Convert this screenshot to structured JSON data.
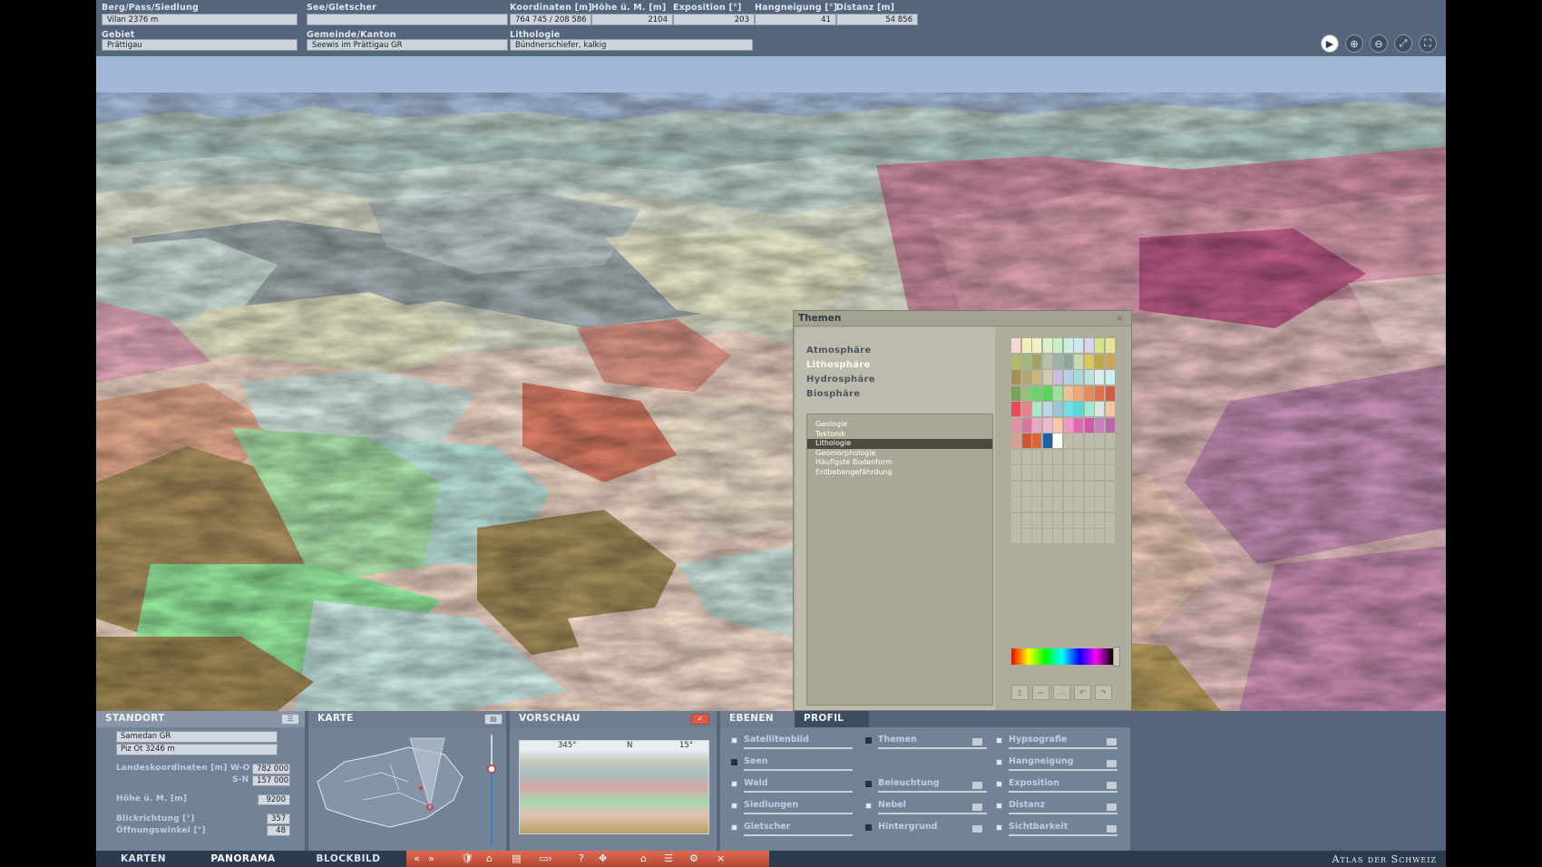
{
  "infobar": {
    "berg": {
      "label": "Berg/Pass/Siedlung",
      "value": "Vilan   2376 m"
    },
    "see": {
      "label": "See/Gletscher",
      "value": ""
    },
    "koordinaten": {
      "label": "Koordinaten [m]",
      "value": "764 745  /  208 586"
    },
    "hoehe": {
      "label": "Höhe ü. M. [m]",
      "value": "2104"
    },
    "exposition": {
      "label": "Exposition [°]",
      "value": "203"
    },
    "hangneigung": {
      "label": "Hangneigung [°]",
      "value": "41"
    },
    "distanz": {
      "label": "Distanz [m]",
      "value": "54 856"
    },
    "gebiet": {
      "label": "Gebiet",
      "value": "Prättigau"
    },
    "gemeinde": {
      "label": "Gemeinde/Kanton",
      "value": "Seewis im Prättigau   GR"
    },
    "lithologie": {
      "label": "Lithologie",
      "value": "Bündnerschiefer, kalkig"
    }
  },
  "toolbar_icons": [
    "play-icon",
    "zoom-in-icon",
    "zoom-out-icon",
    "fit-view-icon",
    "fullscreen-icon"
  ],
  "themen": {
    "title": "Themen",
    "close": "×",
    "spheres": [
      "Atmosphäre",
      "Lithosphäre",
      "Hydrosphäre",
      "Biosphäre"
    ],
    "active_sphere": "Lithosphäre",
    "topics": [
      "Geologie",
      "Tektonik",
      "Lithologie",
      "Geomorphologie",
      "Häufigste Bodenform",
      "Erdbebengefährdung"
    ],
    "selected_topic": "Lithologie",
    "palette": [
      "#f6d5d2",
      "#eef0b8",
      "#f2f0c6",
      "#d9f0c4",
      "#cbeec9",
      "#c9f0e2",
      "#cfe6f0",
      "#dcd2ee",
      "#d4e68a",
      "#e6e39a",
      "#b4b96a",
      "#9fba7a",
      "#a3a06a",
      "#b7c0a8",
      "#9eb1a8",
      "#8fa5a0",
      "#c9d6b0",
      "#d9c85a",
      "#bfa84a",
      "#c9a55e",
      "#a58f52",
      "#b5a474",
      "#c9b87e",
      "#cfcab2",
      "#c9bce0",
      "#b3cfea",
      "#a8d8d8",
      "#bde0e0",
      "#d3f0f0",
      "#c9f0f7",
      "#7aa05a",
      "#90c47a",
      "#6fd06f",
      "#55d655",
      "#9ee09e",
      "#e8c09a",
      "#f0a878",
      "#e88a5a",
      "#e07050",
      "#d05a48",
      "#e84a5a",
      "#e88090",
      "#a8e8c8",
      "#b8d8e8",
      "#98c8d8",
      "#70e0e8",
      "#58d8d8",
      "#a0e8d8",
      "#d8e8e0",
      "#f0c8a8",
      "#e090a8",
      "#d878a0",
      "#e8a8c8",
      "#f0b8d0",
      "#f8c8a8",
      "#f098c8",
      "#e068b8",
      "#d058a8",
      "#c880c0",
      "#b868a8",
      "#d8a090",
      "#c85838",
      "#d86838",
      "#2060a8",
      "#ffffff"
    ]
  },
  "bottom": {
    "standort": {
      "title": "STANDORT",
      "place": "Samedan   GR",
      "peak": "Piz Ot   3246 m",
      "landeskoord_label": "Landeskoordinaten [m]",
      "wo_label": "W-O",
      "wo_value": "782 000",
      "sn_label": "S-N",
      "sn_value": "157 000",
      "hoehe_label": "Höhe ü. M. [m]",
      "hoehe_value": "9200",
      "blickrichtung_label": "Blickrichtung [°]",
      "blickrichtung_value": "357",
      "oeffnung_label": "Öffnungswinkel [°]",
      "oeffnung_value": "48"
    },
    "karte": {
      "title": "KARTE"
    },
    "vorschau": {
      "title": "VORSCHAU",
      "left_deg": "345°",
      "center": "N",
      "right_deg": "15°"
    },
    "ebenen": {
      "tab_ebenen": "EBENEN",
      "tab_profil": "PROFIL",
      "col1": [
        {
          "label": "Satellitenbild",
          "on": false
        },
        {
          "label": "Seen",
          "on": true
        },
        {
          "label": "Wald",
          "on": false
        },
        {
          "label": "Siedlungen",
          "on": false
        },
        {
          "label": "Gletscher",
          "on": false
        }
      ],
      "col2": [
        {
          "label": "Themen",
          "on": true
        },
        {
          "label": "Beleuchtung",
          "on": true
        },
        {
          "label": "Nebel",
          "on": false
        },
        {
          "label": "Hintergrund",
          "on": true
        }
      ],
      "col3": [
        {
          "label": "Hypsografie",
          "on": false
        },
        {
          "label": "Hangneigung",
          "on": false
        },
        {
          "label": "Exposition",
          "on": false
        },
        {
          "label": "Distanz",
          "on": false
        },
        {
          "label": "Sichtbarkeit",
          "on": false
        }
      ]
    }
  },
  "nav": {
    "karten": "KARTEN",
    "panorama": "PANORAMA",
    "blockbild": "BLOCKBILD",
    "brand": "Atlas der Schweiz",
    "tools": [
      "«",
      "»",
      "🛡",
      "⌂",
      "▤",
      "▭›",
      "?",
      "✥",
      "⌂",
      "☰",
      "⚙",
      "×"
    ]
  }
}
